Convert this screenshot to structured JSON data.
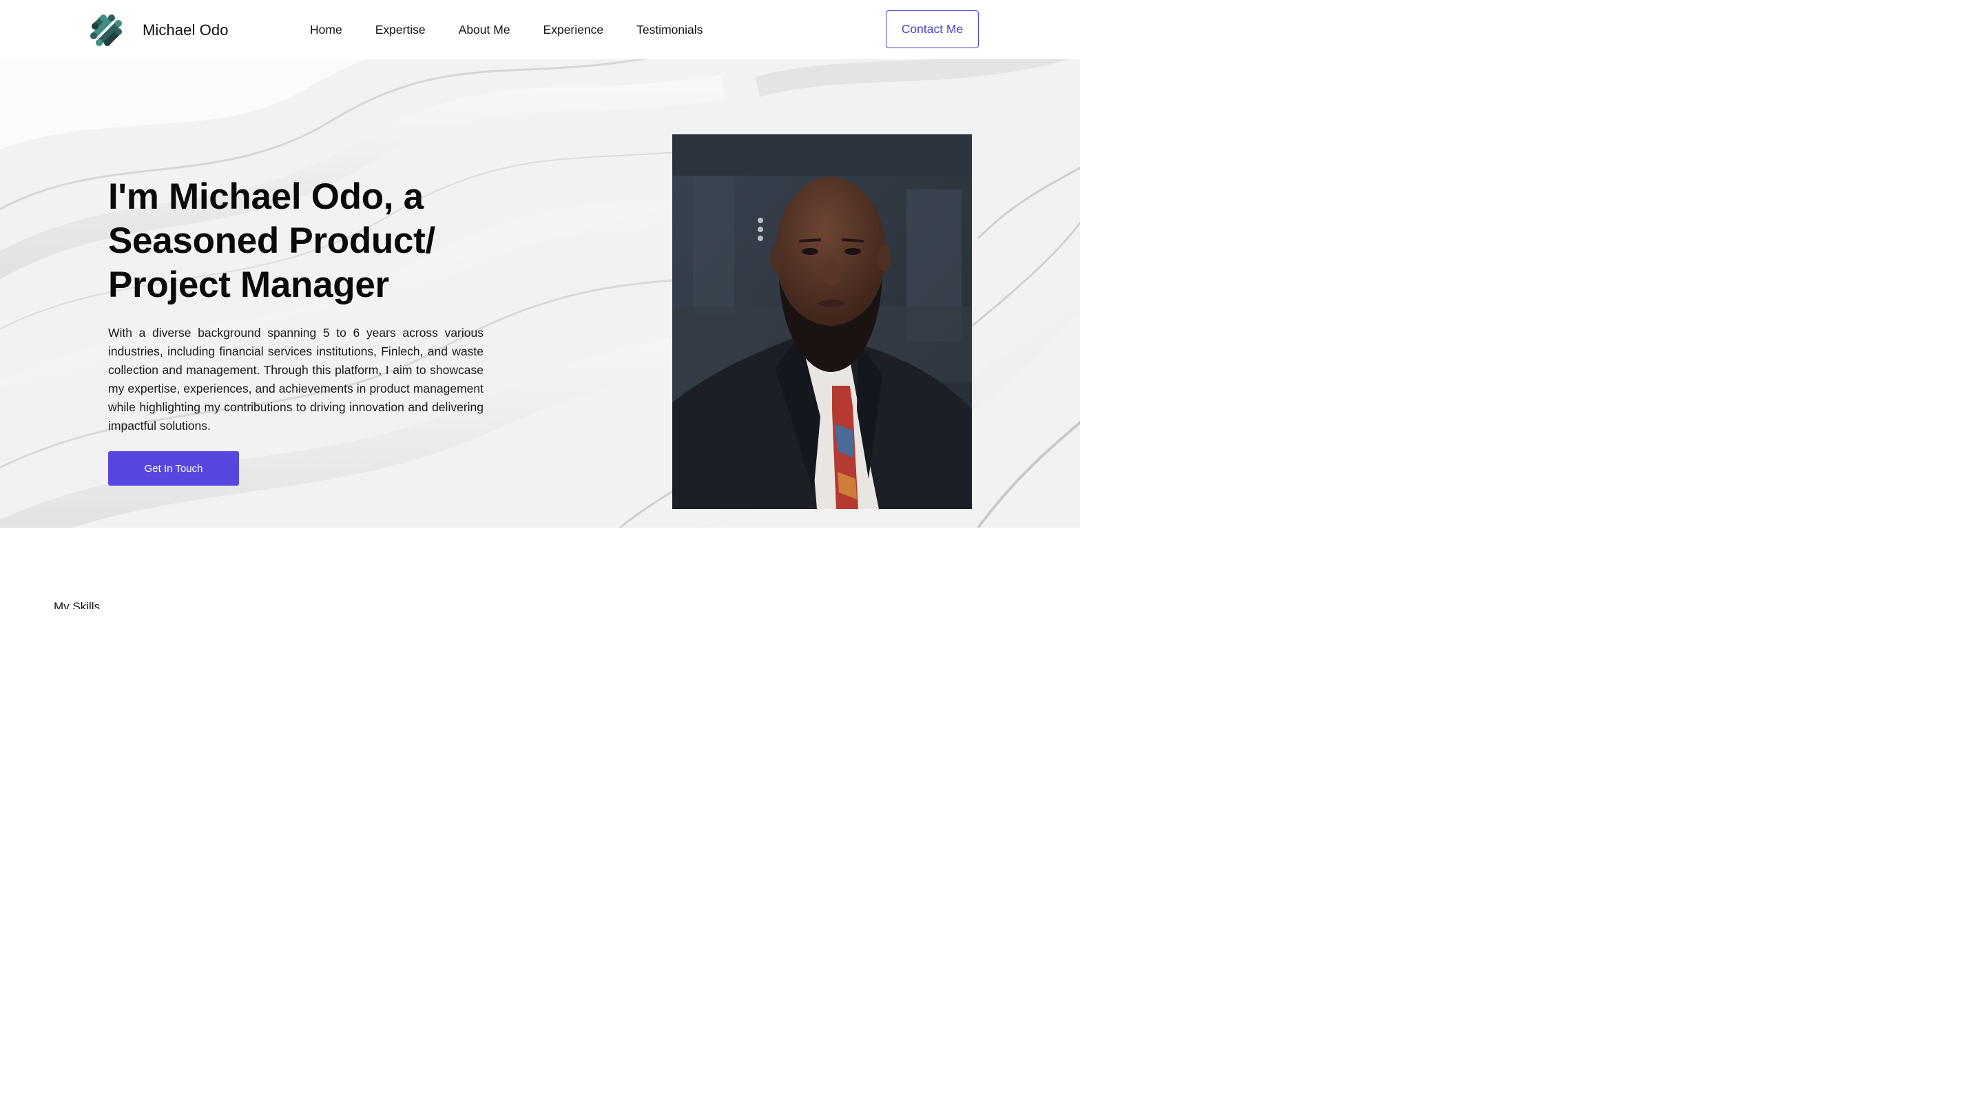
{
  "header": {
    "logo_icon": "helix-dots-logo-icon",
    "logo_colors": [
      "#2d5f5c",
      "#3f8f86",
      "#1f3f3d"
    ],
    "brand_name": "Michael Odo",
    "nav": [
      {
        "label": "Home"
      },
      {
        "label": "Expertise"
      },
      {
        "label": "About Me"
      },
      {
        "label": "Experience"
      },
      {
        "label": "Testimonials"
      }
    ],
    "contact_button": "Contact Me"
  },
  "hero": {
    "title": "I'm Michael Odo, a Seasoned Product/ Project Manager",
    "description": "With a diverse background spanning 5 to 6 years across various industries, including financial services institutions, Finlech, and waste collection and management. Through this platform, I aim to showcase my expertise, experiences, and achievements in product management while highlighting my contributions to driving innovation and delivering impactful solutions.",
    "cta": "Get In Touch",
    "portrait_icon": "profile-portrait-photo"
  },
  "skills": {
    "label": "My Skills"
  },
  "colors": {
    "accent": "#5846e0",
    "outline_accent": "#4a3fd1",
    "hero_background": "#f3f3f3",
    "text": "#111111"
  }
}
